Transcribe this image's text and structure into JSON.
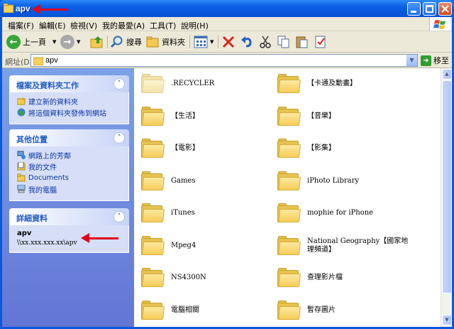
{
  "window": {
    "title": "apv"
  },
  "menu": [
    "檔案(F)",
    "編輯(E)",
    "檢視(V)",
    "我的最愛(A)",
    "工具(T)",
    "說明(H)"
  ],
  "toolbar": {
    "back_label": "上一頁",
    "search_label": "搜尋",
    "folders_label": "資料夾"
  },
  "address": {
    "label": "網址(D)",
    "value": "apv",
    "go_label": "移至"
  },
  "left_pane": {
    "tasks": {
      "title": "檔案及資料夾工作",
      "items": [
        {
          "label": "建立新的資料夾",
          "icon": "new-folder-icon"
        },
        {
          "label": "將這個資料夾發佈到網站",
          "icon": "publish-web-icon"
        }
      ]
    },
    "places": {
      "title": "其他位置",
      "items": [
        {
          "label": "網路上的芳鄰",
          "icon": "network-icon"
        },
        {
          "label": "我的文件",
          "icon": "my-documents-icon"
        },
        {
          "label": "Documents",
          "icon": "folder-icon"
        },
        {
          "label": "我的電腦",
          "icon": "my-computer-icon"
        }
      ]
    },
    "details": {
      "title": "詳細資料",
      "name": "apv",
      "path": "\\\\xx.xxx.xxx.xx\\apv"
    }
  },
  "items": [
    ".RECYCLER",
    "【卡通及動畫】",
    "【生活】",
    "【音樂】",
    "【電影】",
    "【影集】",
    "Games",
    "iPhoto Library",
    "iTunes",
    "mophie for iPhone",
    "Mpeg4",
    "National Geography【國家地理頻道】",
    "NS4300N",
    "查理影片檔",
    "電腦相關",
    "暫存圖片"
  ],
  "colors": {
    "accent": "#e0001b",
    "title_bar": "#0a5ee4",
    "link": "#0c32a8"
  }
}
